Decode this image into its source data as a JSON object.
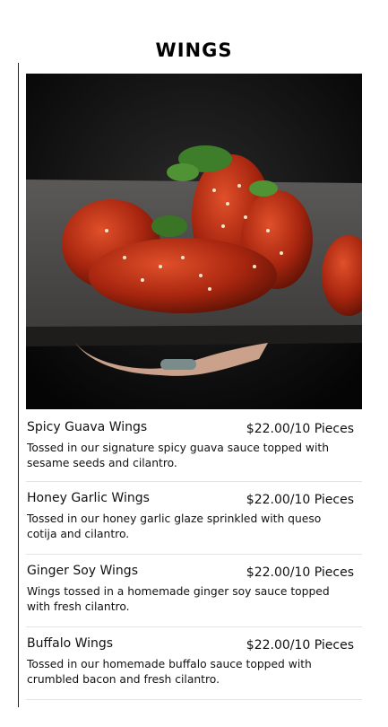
{
  "header": {
    "title": "WINGS"
  },
  "hero": {
    "alt": "Spicy guava wings with sesame seeds and cilantro on a slate tray",
    "icon": "food-photo"
  },
  "menu": {
    "items": [
      {
        "name": "Spicy Guava Wings",
        "price": "$22.00/10 Pieces",
        "description": "Tossed in our signature spicy guava sauce topped with sesame seeds and cilantro."
      },
      {
        "name": "Honey Garlic Wings",
        "price": "$22.00/10 Pieces",
        "description": "Tossed in our honey garlic glaze sprinkled with queso cotija and cilantro."
      },
      {
        "name": "Ginger Soy Wings",
        "price": "$22.00/10 Pieces",
        "description": "Wings tossed in a homemade ginger soy sauce topped with fresh cilantro."
      },
      {
        "name": "Buffalo Wings",
        "price": "$22.00/10 Pieces",
        "description": "Tossed in our homemade buffalo sauce topped with crumbled bacon and fresh cilantro."
      }
    ]
  },
  "colors": {
    "text": "#111111",
    "divider": "#e3e3e3",
    "background": "#ffffff"
  }
}
